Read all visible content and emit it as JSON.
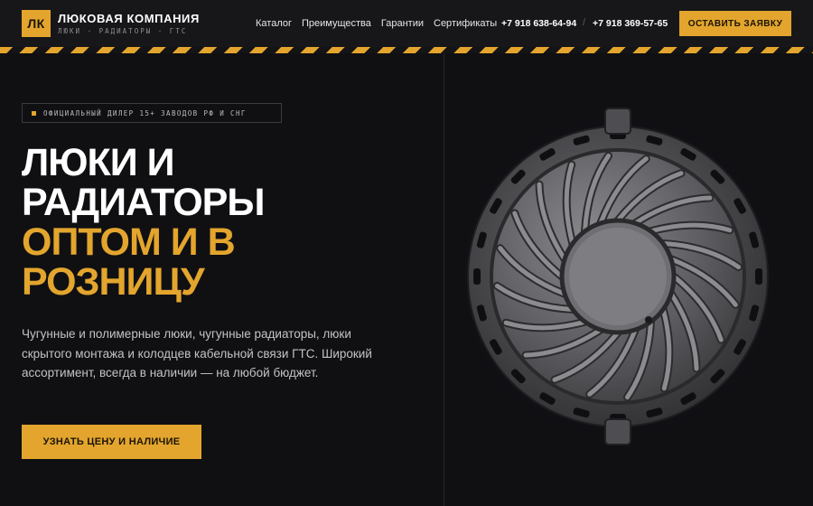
{
  "header": {
    "logo_text": "ЛК",
    "brand_name": "ЛЮКОВАЯ КОМПАНИЯ",
    "brand_sub": "ЛЮКИ · РАДИАТОРЫ · ГТС",
    "nav": [
      "Каталог",
      "Преимущества",
      "Гарантии",
      "Сертификаты"
    ],
    "phone1": "+7 918 638-64-94",
    "phone_separator": "/",
    "phone2": "+7 918 369-57-65",
    "cta": "ОСТАВИТЬ ЗАЯВКУ"
  },
  "hero": {
    "badge": "ОФИЦИАЛЬНЫЙ ДИЛЕР 15+ ЗАВОДОВ РФ И СНГ",
    "title_lines": [
      "ЛЮКИ И",
      "РАДИАТОРЫ"
    ],
    "accent_lines": [
      "ОПТОМ И В",
      "РОЗНИЦУ"
    ],
    "description": "Чугунные и полимерные люки, чугунные радиаторы, люки скрытого монтажа и колодцев кабельной связи ГТС. Широкий ассортимент, всегда в наличии — на любой бюджет.",
    "cta": "УЗНАТЬ ЦЕНУ И НАЛИЧИЕ"
  },
  "image": {
    "subject": "manhole-cover-image"
  },
  "colors": {
    "accent": "#e3a52d",
    "background": "#101013",
    "header": "#17171a"
  }
}
